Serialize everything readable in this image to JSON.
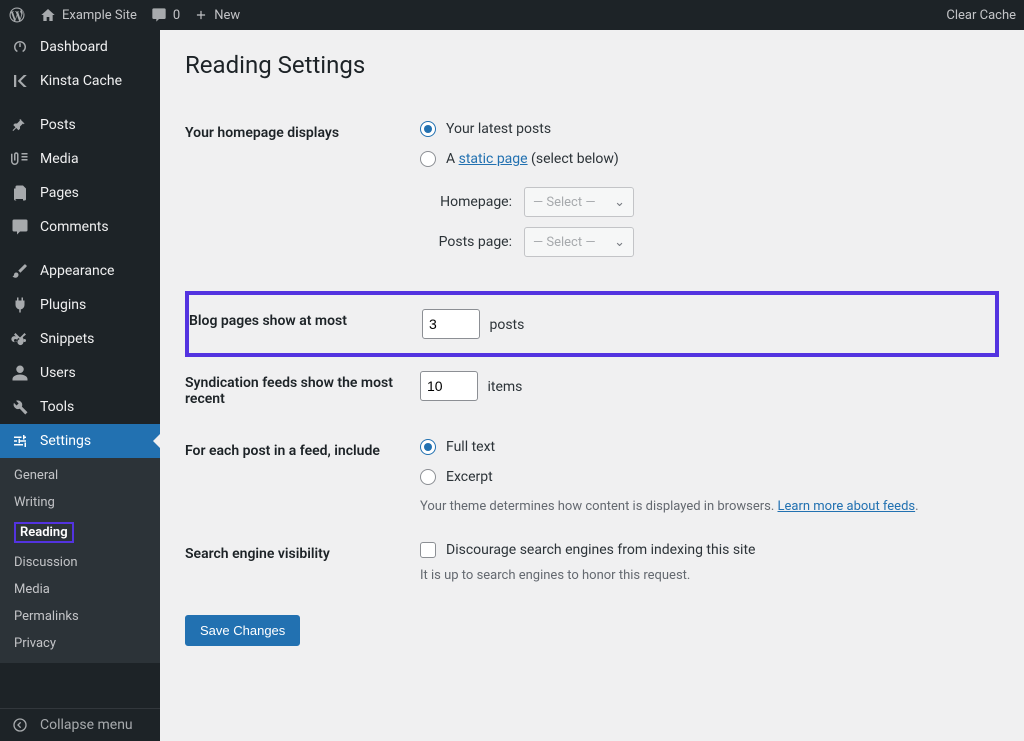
{
  "adminbar": {
    "site_name": "Example Site",
    "comments_count": "0",
    "new_label": "New",
    "clear_cache": "Clear Cache"
  },
  "sidebar": {
    "items": [
      {
        "label": "Dashboard"
      },
      {
        "label": "Kinsta Cache"
      },
      {
        "label": "Posts"
      },
      {
        "label": "Media"
      },
      {
        "label": "Pages"
      },
      {
        "label": "Comments"
      },
      {
        "label": "Appearance"
      },
      {
        "label": "Plugins"
      },
      {
        "label": "Snippets"
      },
      {
        "label": "Users"
      },
      {
        "label": "Tools"
      },
      {
        "label": "Settings"
      }
    ],
    "submenu": [
      {
        "label": "General"
      },
      {
        "label": "Writing"
      },
      {
        "label": "Reading"
      },
      {
        "label": "Discussion"
      },
      {
        "label": "Media"
      },
      {
        "label": "Permalinks"
      },
      {
        "label": "Privacy"
      }
    ],
    "collapse": "Collapse menu"
  },
  "page": {
    "title": "Reading Settings",
    "homepage_displays_label": "Your homepage displays",
    "opt_latest": "Your latest posts",
    "opt_static_a": "A ",
    "opt_static_link": "static page",
    "opt_static_after": " (select below)",
    "homepage_label": "Homepage:",
    "postspage_label": "Posts page:",
    "select_placeholder": "— Select —",
    "blog_pages_label": "Blog pages show at most",
    "blog_pages_value": "3",
    "blog_pages_suffix": "posts",
    "syndication_label": "Syndication feeds show the most recent",
    "syndication_value": "10",
    "syndication_suffix": "items",
    "feed_include_label": "For each post in a feed, include",
    "feed_full": "Full text",
    "feed_excerpt": "Excerpt",
    "feed_desc": "Your theme determines how content is displayed in browsers. ",
    "feed_learn": "Learn more about feeds",
    "feed_desc_end": ".",
    "search_label": "Search engine visibility",
    "search_checkbox": "Discourage search engines from indexing this site",
    "search_desc": "It is up to search engines to honor this request.",
    "save": "Save Changes"
  }
}
